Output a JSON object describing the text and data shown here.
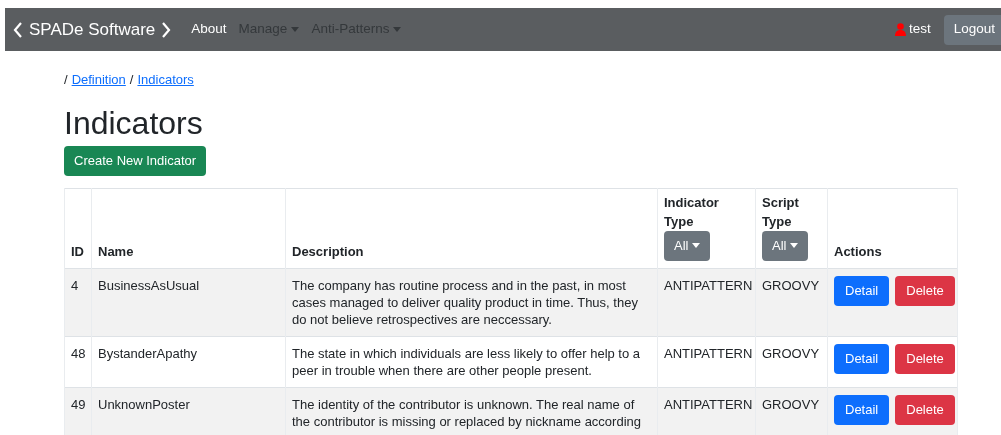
{
  "navbar": {
    "brand": "SPADe Software",
    "items": [
      {
        "label": "About",
        "dropdown": false,
        "selected": true
      },
      {
        "label": "Manage",
        "dropdown": true,
        "selected": false
      },
      {
        "label": "Anti-Patterns",
        "dropdown": true,
        "selected": false
      }
    ],
    "user": "test",
    "logout": "Logout"
  },
  "breadcrumb": [
    {
      "separator": "/",
      "label": "Definition"
    },
    {
      "separator": "/",
      "label": "Indicators"
    }
  ],
  "title": "Indicators",
  "create_button": "Create New Indicator",
  "table": {
    "columns": [
      {
        "label": "ID"
      },
      {
        "label": "Name"
      },
      {
        "label": "Description"
      },
      {
        "label": "Indicator Type",
        "filter": "All"
      },
      {
        "label": "Script Type",
        "filter": "All"
      },
      {
        "label": "Actions"
      }
    ],
    "rows": [
      {
        "id": "4",
        "name": "BusinessAsUsual",
        "description": "The company has routine process and in the past, in most cases managed to deliver quality product in time. Thus, they do not believe retrospectives are neccessary.",
        "indicator_type": "ANTIPATTERN",
        "script_type": "GROOVY",
        "detail": "Detail",
        "delete": "Delete"
      },
      {
        "id": "48",
        "name": "BystanderApathy",
        "description": "The state in which individuals are less likely to offer help to a peer in trouble when there are other people present.",
        "indicator_type": "ANTIPATTERN",
        "script_type": "GROOVY",
        "detail": "Detail",
        "delete": "Delete"
      },
      {
        "id": "49",
        "name": "UnknownPoster",
        "description": "The identity of the contributor is unknown. The real name of the contributor is missing or replaced by nickname according",
        "indicator_type": "ANTIPATTERN",
        "script_type": "GROOVY",
        "detail": "Detail",
        "delete": "Delete"
      }
    ]
  }
}
